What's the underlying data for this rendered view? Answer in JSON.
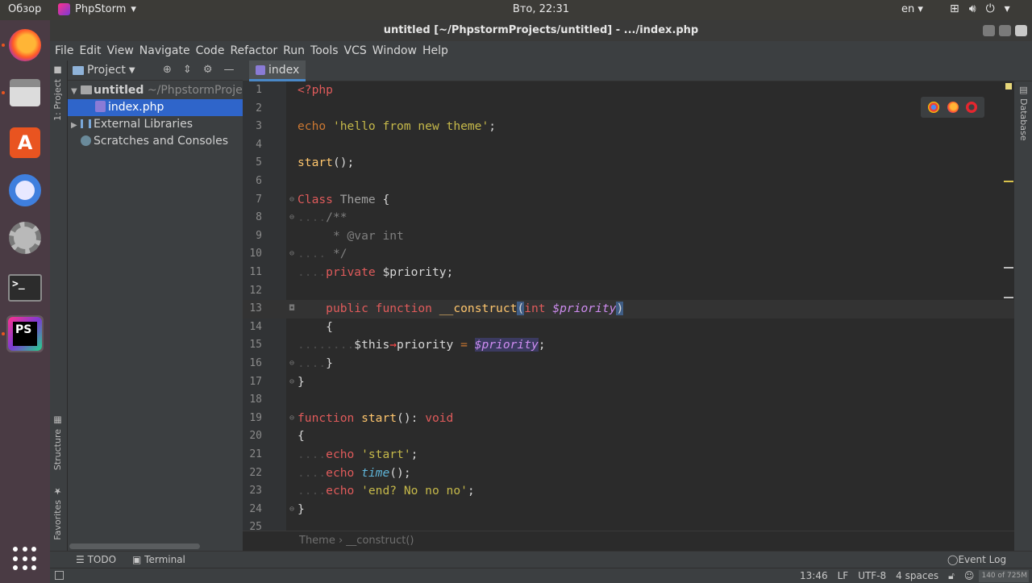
{
  "top_panel": {
    "overview": "Обзор",
    "app_name": "PhpStorm",
    "clock": "Вто, 22:31",
    "lang": "en"
  },
  "window": {
    "title": "untitled [~/PhpstormProjects/untitled] - .../index.php"
  },
  "menu": [
    "File",
    "Edit",
    "View",
    "Navigate",
    "Code",
    "Refactor",
    "Run",
    "Tools",
    "VCS",
    "Window",
    "Help"
  ],
  "side_tabs": {
    "project": "1: Project",
    "structure": "Structure",
    "favorites": "Favorites",
    "database": "Database"
  },
  "project_panel": {
    "title": "Project",
    "root": "untitled",
    "root_path": "~/PhpstormProjects/untitled",
    "file": "index.php",
    "external_libraries": "External Libraries",
    "scratches": "Scratches and Consoles"
  },
  "editor": {
    "tab": "index",
    "current_line": 13,
    "lines": [
      "1",
      "2",
      "3",
      "4",
      "5",
      "6",
      "7",
      "8",
      "9",
      "10",
      "11",
      "12",
      "13",
      "14",
      "15",
      "16",
      "17",
      "18",
      "19",
      "20",
      "21",
      "22",
      "23",
      "24",
      "25"
    ],
    "code": {
      "l1": "<?php",
      "l3_kw": "echo",
      "l3_str": "'hello from new theme'",
      "l5_fn": "start",
      "l5_rest": "();",
      "l7_kw": "Class",
      "l7_name": "Theme",
      "l7_brace": " {",
      "l8": "/**",
      "l9": " * @var int",
      "l10": " */",
      "l11_kw": "private",
      "l11_var": " $priority;",
      "l13_public": "public",
      "l13_function": "function",
      "l13_name": "__construct",
      "l13_int": "int",
      "l13_param": "$priority",
      "l14": "{",
      "l15_this": "$this",
      "l15_arrow": "→",
      "l15_prop": "priority",
      "l15_eq": " = ",
      "l15_var": "$priority",
      "l16": "}",
      "l17": "}",
      "l19_kw": "function",
      "l19_name": "start",
      "l19_void": "void",
      "l20": "{",
      "l21_kw": "echo",
      "l21_str": "'start'",
      "l22_kw": "echo",
      "l22_fn": "time",
      "l23_kw": "echo",
      "l23_str": "'end? No no no'",
      "l24": "}"
    },
    "breadcrumbs": "Theme  ›  __construct()"
  },
  "bottom_tools": {
    "todo": "TODO",
    "terminal": "Terminal",
    "event_log": "Event Log"
  },
  "status": {
    "position": "13:46",
    "line_sep": "LF",
    "encoding": "UTF-8",
    "indent": "4 spaces",
    "memory": "140 of 725M"
  },
  "colors": {
    "accent": "#2f65ca",
    "keyword": "#cc7832",
    "string": "#c6b94a",
    "function": "#ffc66d"
  }
}
